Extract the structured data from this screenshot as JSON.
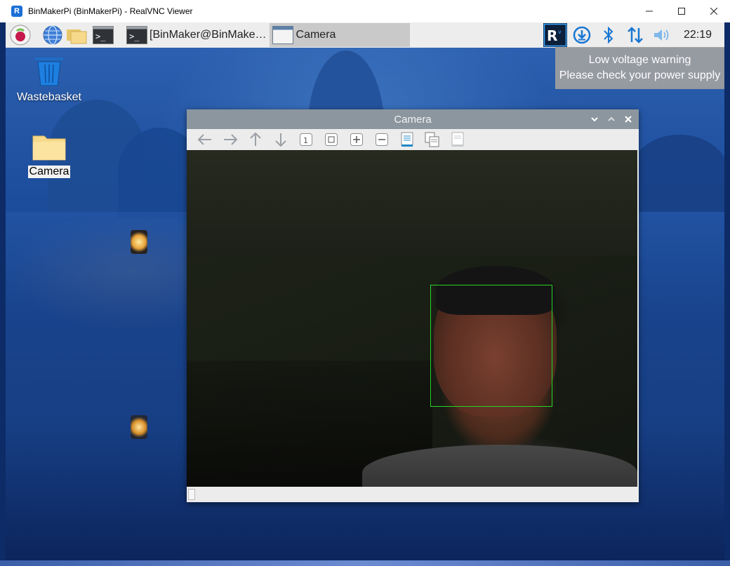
{
  "window": {
    "title": "BinMakerPi (BinMakerPi) - RealVNC Viewer",
    "app_icon": "realvnc-icon",
    "controls": [
      "minimize-icon",
      "maximize-icon",
      "close-icon"
    ]
  },
  "taskbar": {
    "launchers": [
      "raspberry-menu-icon",
      "web-browser-icon",
      "file-manager-icon",
      "terminal-icon"
    ],
    "tasks": [
      {
        "label": "[BinMaker@BinMake…",
        "icon": "terminal-icon",
        "active": false
      },
      {
        "label": "Camera",
        "icon": "window-icon",
        "active": true
      }
    ],
    "tray": [
      "vnc-icon",
      "download-icon",
      "bluetooth-icon",
      "network-icon",
      "volume-icon"
    ],
    "clock": "22:19"
  },
  "notification": {
    "line1": "Low voltage warning",
    "line2": "Please check your power supply"
  },
  "desktop": {
    "icons": [
      {
        "label": "Wastebasket",
        "icon": "trash-icon",
        "selected": false
      },
      {
        "label": "Camera",
        "icon": "folder-icon",
        "selected": true
      }
    ]
  },
  "camera_window": {
    "title": "Camera",
    "controls": [
      "minimize-icon",
      "maximize-icon",
      "close-icon"
    ],
    "toolbar": [
      "arrow-left-icon",
      "arrow-right-icon",
      "arrow-up-icon",
      "arrow-down-icon",
      "zoom-original-icon",
      "zoom-fit-icon",
      "zoom-in-icon",
      "zoom-out-icon",
      "save-icon",
      "copy-icon",
      "properties-icon"
    ],
    "detection": "face-detection-box"
  },
  "colors": {
    "taskbar_bg": "#ededed",
    "camera_titlebar": "#8c969e",
    "face_box": "#27d427",
    "notification_bg": "#a0a0a0"
  }
}
